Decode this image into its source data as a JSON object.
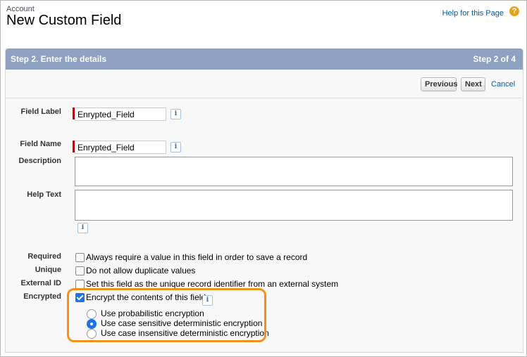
{
  "header": {
    "breadcrumb": "Account",
    "title": "New Custom Field",
    "help_link": "Help for this Page",
    "help_icon": "question-circle-icon"
  },
  "step": {
    "title": "Step 2. Enter the details",
    "count": "Step 2 of 4"
  },
  "buttons": {
    "previous": "Previous",
    "next": "Next",
    "cancel": "Cancel"
  },
  "form": {
    "field_label": {
      "label": "Field Label",
      "value": "Enrypted_Field"
    },
    "field_name": {
      "label": "Field Name",
      "value": "Enrypted_Field"
    },
    "description": {
      "label": "Description",
      "value": ""
    },
    "help_text": {
      "label": "Help Text",
      "value": ""
    },
    "required": {
      "label": "Required",
      "text": "Always require a value in this field in order to save a record",
      "checked": false
    },
    "unique": {
      "label": "Unique",
      "text": "Do not allow duplicate values",
      "checked": false
    },
    "external_id": {
      "label": "External ID",
      "text": "Set this field as the unique record identifier from an external system",
      "checked": false
    },
    "encrypted": {
      "label": "Encrypted",
      "text": "Encrypt the contents of this field",
      "checked": true,
      "options": [
        {
          "label": "Use probabilistic encryption",
          "selected": false
        },
        {
          "label": "Use case sensitive deterministic encryption",
          "selected": true
        },
        {
          "label": "Use case insensitive deterministic encryption",
          "selected": false
        }
      ]
    }
  },
  "info_icon_glyph": "i",
  "colors": {
    "step_header": "#8ea1c1",
    "link": "#015ba7",
    "required_bar": "#cc0000",
    "highlight": "#f0931e",
    "control_accent": "#1a73e8",
    "help_icon": "#e8a418"
  }
}
